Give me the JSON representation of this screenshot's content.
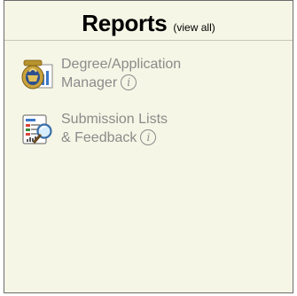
{
  "panel": {
    "title": "Reports",
    "view_all_label": "(view all)"
  },
  "items": [
    {
      "line1": "Degree/Application",
      "line2": "Manager",
      "info_glyph": "i",
      "icon": "ffa-emblem-report-icon"
    },
    {
      "line1": "Submission Lists",
      "line2": "& Feedback",
      "info_glyph": "i",
      "icon": "report-magnifier-icon"
    }
  ],
  "colors": {
    "panel_background": "#f6f6e6",
    "item_text": "#8b8b8b",
    "border": "#6c6c6c"
  }
}
